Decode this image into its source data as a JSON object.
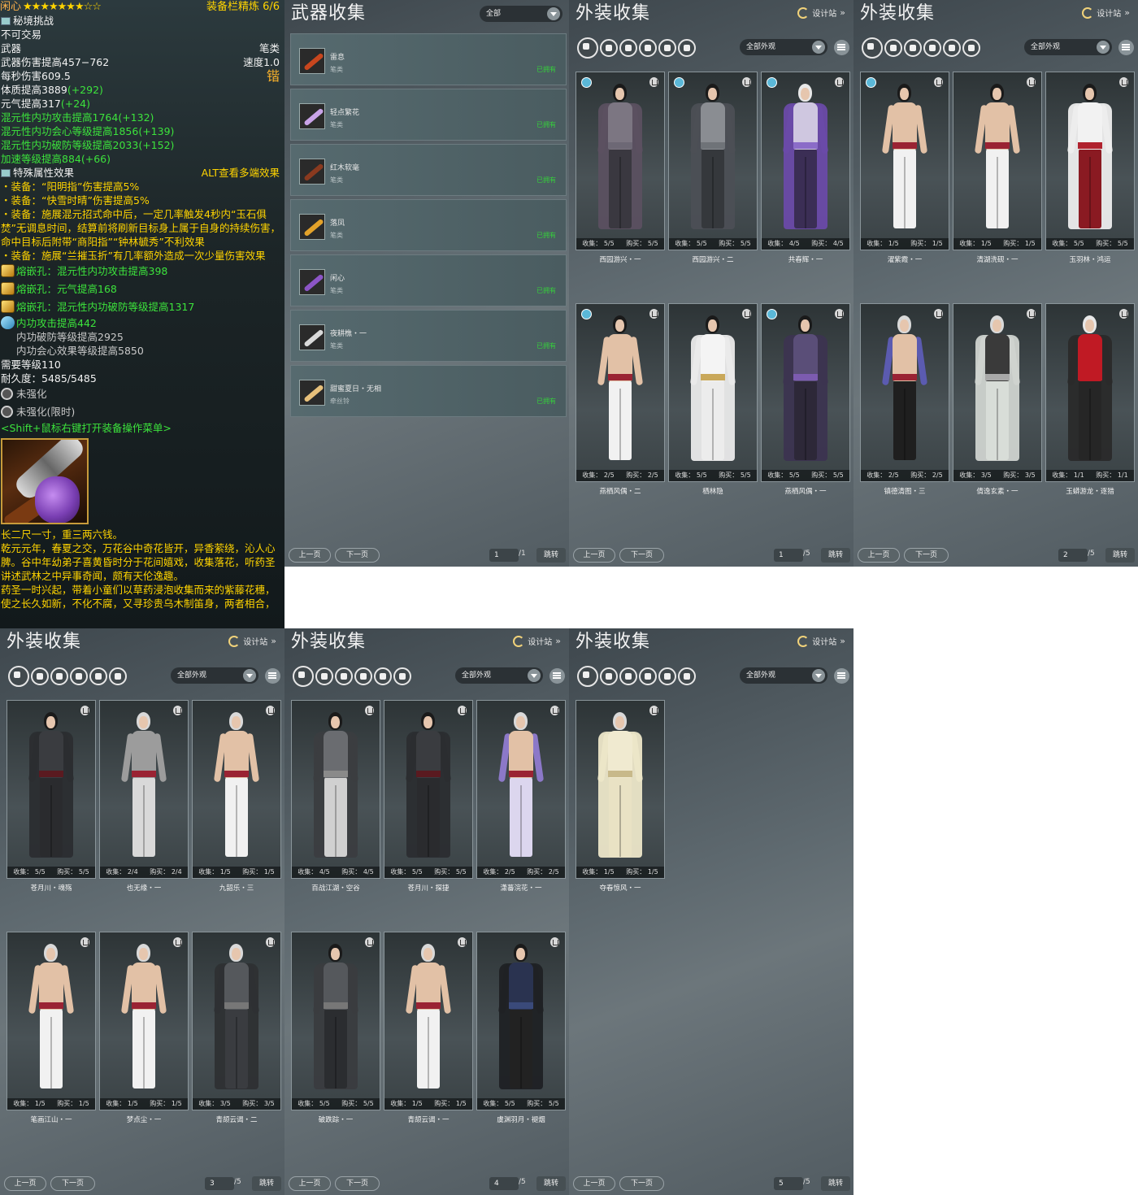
{
  "tooltip": {
    "title": "闲心",
    "stars": "★★★★★★★☆☆",
    "refine": "装备栏精炼 6/6",
    "source": "秘境挑战",
    "untradable": "不可交易",
    "slot": "武器",
    "weapon_type": "笔类",
    "damage": "武器伤害提高457−762",
    "speed": "速度1.0",
    "dps": "每秒伤害609.5",
    "seal_char": "锴",
    "attrs": [
      {
        "text": "体质提高3889",
        "bonus": "(+292)",
        "color": "white"
      },
      {
        "text": "元气提高317",
        "bonus": "(+24)",
        "color": "white"
      },
      {
        "text": "混元性内功攻击提高1764",
        "bonus": "(+132)",
        "color": "green"
      },
      {
        "text": "混元性内功会心等级提高1856",
        "bonus": "(+139)",
        "color": "green"
      },
      {
        "text": "混元性内功破防等级提高2033",
        "bonus": "(+152)",
        "color": "green"
      },
      {
        "text": "加速等级提高884",
        "bonus": "(+66)",
        "color": "green"
      }
    ],
    "special_header": "特殊属性效果",
    "alt_hint": "ALT查看多端效果",
    "effects": [
      "・装备：“阳明指”伤害提高5%",
      "・装备：“快雪时晴”伤害提高5%",
      "・装备：施展混元招式命中后，一定几率触发4秒内“玉石俱焚”无调息时间，结算前将刷新目标身上属于自身的持续伤害，命中目标后附带“商阳指”“钟林毓秀”不利效果",
      "・装备：施展“兰摧玉折”有几率额外造成一次少量伤害效果"
    ],
    "sockets": [
      "熔嵌孔：混元性内功攻击提高398",
      "熔嵌孔：元气提高168",
      "熔嵌孔：混元性内功破防等级提高1317"
    ],
    "enchant_main": "内功攻击提高442",
    "enchant_sub": [
      "内功破防等级提高2925",
      "内功会心效果等级提高5850"
    ],
    "level_req": "需要等级110",
    "durability": "耐久度：5485/5485",
    "not_enhanced": "未强化",
    "not_enhanced_limited": "未强化(限时)",
    "shift_hint": "<Shift+鼠标右键打开装备操作菜单>",
    "lore": [
      "长二尺一寸，重三两六钱。",
      "乾元元年，春夏之交，万花谷中奇花皆开，异香萦绕，沁人心脾。谷中年幼弟子喜黄昏时分于花间嬉戏，收集落花，听药圣讲述武林之中异事奇闻，颇有天伦逸趣。",
      "药圣一时兴起，带着小童们以草药浸泡收集而来的紫藤花穗，使之长久如新，不化不腐，又寻珍贵乌木制笛身，两者相合，"
    ]
  },
  "weapon_panel": {
    "title": "武器收集",
    "filter": "全部",
    "items": [
      {
        "name": "雷息",
        "type": "笔类",
        "status": "已拥有",
        "icon": "#c8461e"
      },
      {
        "name": "轻点繁花",
        "type": "笔类",
        "status": "已拥有",
        "icon": "#c9a3e8"
      },
      {
        "name": "红木软毫",
        "type": "笔类",
        "status": "已拥有",
        "icon": "#8a3a1f"
      },
      {
        "name": "落凤",
        "type": "笔类",
        "status": "已拥有",
        "icon": "#e3a22a"
      },
      {
        "name": "闲心",
        "type": "笔类",
        "status": "已拥有",
        "icon": "#8c55c6"
      },
      {
        "name": "夜耕樵・一",
        "type": "笔类",
        "status": "已拥有",
        "icon": "#d9d9d9"
      },
      {
        "name": "甜蜜夏日・无相",
        "type": "牵丝铃",
        "status": "已拥有",
        "icon": "#e7c07b"
      }
    ],
    "pager": {
      "prev": "上一页",
      "next": "下一页",
      "page": "1",
      "total": "/1",
      "jump": "跳转"
    }
  },
  "appearance_common": {
    "title": "外装收集",
    "designer": "设计站",
    "filter": "全部外观",
    "prev": "上一页",
    "next": "下一页",
    "jump": "跳转"
  },
  "appearance_panels": [
    {
      "page": "1",
      "total": "/5",
      "cards": [
        {
          "name": "西园游兴・一",
          "collect": "5/5",
          "buy": "5/5",
          "tag": true,
          "hair": "#1a1a1a",
          "robe": "#5b5060",
          "top": "#7c7682",
          "legs": "#3a3840",
          "sash": "#6d6875",
          "arm": "#5b5060"
        },
        {
          "name": "西园游兴・二",
          "collect": "5/5",
          "buy": "5/5",
          "tag": true,
          "hair": "#1a1a1a",
          "robe": "#4c4f55",
          "top": "#8a8d92",
          "legs": "#35383c",
          "sash": "#6f7378",
          "arm": "#4c4f55"
        },
        {
          "name": "共春辉・一",
          "collect": "4/5",
          "buy": "4/5",
          "tag": true,
          "hair": "#e8e8e8",
          "robe": "#6a4aa8",
          "top": "#cfc7e0",
          "legs": "#3b2e55",
          "sash": "#8b6cc8",
          "arm": "#6a4aa8"
        },
        {
          "name": "燕栖风偶・二",
          "collect": "2/5",
          "buy": "2/5",
          "tag": true,
          "hair": "#1a1a1a",
          "robe": "transparent",
          "top": "#e2c1a6",
          "legs": "#f1f1f1",
          "sash": "#9a2333",
          "arm": "#e2c1a6"
        },
        {
          "name": "栖林隐",
          "collect": "5/5",
          "buy": "5/5",
          "tag": false,
          "hair": "#1a1a1a",
          "robe": "#eaeaea",
          "top": "#f4f4f4",
          "legs": "#ececec",
          "sash": "#c9a85a",
          "arm": "#eaeaea"
        },
        {
          "name": "燕栖风偶・一",
          "collect": "5/5",
          "buy": "5/5",
          "tag": true,
          "hair": "#1a1a1a",
          "robe": "#3c3450",
          "top": "#5a4e78",
          "legs": "#2d2838",
          "sash": "#7c5bb0",
          "arm": "#3c3450"
        }
      ]
    },
    {
      "page": "2",
      "total": "/5",
      "cards": [
        {
          "name": "濯紫霞・一",
          "collect": "1/5",
          "buy": "1/5",
          "tag": true,
          "hair": "#1a1a1a",
          "robe": "transparent",
          "top": "#e2c1a6",
          "legs": "#f1f1f1",
          "sash": "#9a2333",
          "arm": "#e2c1a6"
        },
        {
          "name": "清湖洗砚・一",
          "collect": "1/5",
          "buy": "1/5",
          "tag": false,
          "hair": "#1a1a1a",
          "robe": "transparent",
          "top": "#e2c1a6",
          "legs": "#f1f1f1",
          "sash": "#9a2333",
          "arm": "#e2c1a6"
        },
        {
          "name": "玉羽林・鸿运",
          "collect": "5/5",
          "buy": "5/5",
          "tag": false,
          "hair": "#1a1a1a",
          "robe": "#ededed",
          "top": "#f2f2f2",
          "legs": "#8a1a22",
          "sash": "#b0222e",
          "arm": "#ededed"
        },
        {
          "name": "镇德清图・三",
          "collect": "2/5",
          "buy": "2/5",
          "tag": false,
          "hair": "#d9d9d9",
          "robe": "transparent",
          "top": "#e2c1a6",
          "legs": "#1f1f1f",
          "sash": "#9a2333",
          "arm": "#5b5bb0"
        },
        {
          "name": "倩逸玄素・一",
          "collect": "3/5",
          "buy": "3/5",
          "tag": false,
          "hair": "#d9d9d9",
          "robe": "#cfd3cf",
          "top": "#3a3a3a",
          "legs": "#d8ddd8",
          "sash": "#a8a8a8",
          "arm": "#cfd3cf"
        },
        {
          "name": "玉蟒游龙・逐猎",
          "collect": "1/1",
          "buy": "1/1",
          "tag": false,
          "hair": "#e8e8e8",
          "robe": "#2a2a2a",
          "top": "#c01a24",
          "legs": "#262626",
          "sash": "#c01a24",
          "arm": "#2a2a2a"
        }
      ]
    },
    {
      "page": "3",
      "total": "/5",
      "cards": [
        {
          "name": "苍月川・魂殇",
          "collect": "5/5",
          "buy": "5/5",
          "tag": false,
          "hair": "#1a1a1a",
          "robe": "#2b2d30",
          "top": "#3a3c40",
          "legs": "#2a2b2e",
          "sash": "#5a1a20",
          "arm": "#2b2d30"
        },
        {
          "name": "也无缘・一",
          "collect": "2/4",
          "buy": "2/4",
          "tag": false,
          "hair": "#d9d9d9",
          "robe": "transparent",
          "top": "#9c9c9c",
          "legs": "#d9d9d9",
          "sash": "#9a2333",
          "arm": "#9c9c9c"
        },
        {
          "name": "九韶乐・三",
          "collect": "1/5",
          "buy": "1/5",
          "tag": false,
          "hair": "#d9d9d9",
          "robe": "transparent",
          "top": "#e2c1a6",
          "legs": "#f1f1f1",
          "sash": "#9a2333",
          "arm": "#e2c1a6"
        },
        {
          "name": "笔画江山・一",
          "collect": "1/5",
          "buy": "1/5",
          "tag": false,
          "hair": "#d9d9d9",
          "robe": "transparent",
          "top": "#e2c1a6",
          "legs": "#f1f1f1",
          "sash": "#9a2333",
          "arm": "#e2c1a6"
        },
        {
          "name": "梦点尘・一",
          "collect": "1/5",
          "buy": "1/5",
          "tag": false,
          "hair": "#d9d9d9",
          "robe": "transparent",
          "top": "#e2c1a6",
          "legs": "#f1f1f1",
          "sash": "#9a2333",
          "arm": "#e2c1a6"
        },
        {
          "name": "青颉云谒・二",
          "collect": "3/5",
          "buy": "3/5",
          "tag": false,
          "hair": "#d9d9d9",
          "robe": "#2e3033",
          "top": "#55585c",
          "legs": "#3a3c40",
          "sash": "#777",
          "arm": "#2e3033"
        }
      ]
    },
    {
      "page": "4",
      "total": "/5",
      "cards": [
        {
          "name": "百战江湖・空谷",
          "collect": "4/5",
          "buy": "4/5",
          "tag": false,
          "hair": "#1a1a1a",
          "robe": "#3b3d40",
          "top": "#6a6c70",
          "legs": "#d0d0d0",
          "sash": "#8a8a8a",
          "arm": "#3b3d40"
        },
        {
          "name": "苍月川・探捷",
          "collect": "5/5",
          "buy": "5/5",
          "tag": false,
          "hair": "#1a1a1a",
          "robe": "#2b2d30",
          "top": "#3a3c40",
          "legs": "#2a2b2e",
          "sash": "#5a1a20",
          "arm": "#2b2d30"
        },
        {
          "name": "潇蕃浣花・一",
          "collect": "2/5",
          "buy": "2/5",
          "tag": false,
          "hair": "#d9d9d9",
          "robe": "transparent",
          "top": "#e2c1a6",
          "legs": "#dcd6ee",
          "sash": "#9a2333",
          "arm": "#8c78c8"
        },
        {
          "name": "破跌踪・一",
          "collect": "5/5",
          "buy": "5/5",
          "tag": false,
          "hair": "#1a1a1a",
          "robe": "#3a3c3f",
          "top": "#55585c",
          "legs": "#2b2d30",
          "sash": "#777",
          "arm": "#3a3c3f"
        },
        {
          "name": "青颉云谒・一",
          "collect": "1/5",
          "buy": "1/5",
          "tag": false,
          "hair": "#d9d9d9",
          "robe": "transparent",
          "top": "#e2c1a6",
          "legs": "#f1f1f1",
          "sash": "#9a2333",
          "arm": "#e2c1a6"
        },
        {
          "name": "虞渊羽月・褪烟",
          "collect": "5/5",
          "buy": "5/5",
          "tag": false,
          "hair": "#1a1a1a",
          "robe": "#1f2124",
          "top": "#2a3350",
          "legs": "#222",
          "sash": "#3a4a7a",
          "arm": "#1f2124"
        }
      ]
    },
    {
      "page": "5",
      "total": "/5",
      "cards": [
        {
          "name": "夺春惊风・一",
          "collect": "1/5",
          "buy": "1/5",
          "tag": false,
          "hair": "#d9d9d9",
          "robe": "#ece6c8",
          "top": "#f0ead0",
          "legs": "#e9e2c4",
          "sash": "#c8b98a",
          "arm": "#ece6c8"
        }
      ]
    }
  ],
  "labels": {
    "collect": "收集：",
    "buy": "购买："
  }
}
